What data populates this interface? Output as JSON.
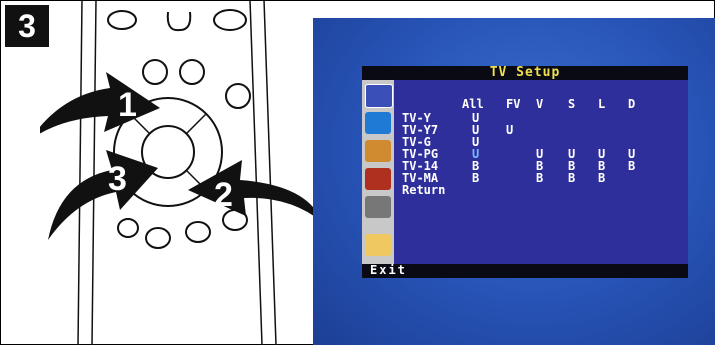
{
  "step_number": "3",
  "callouts": [
    "1",
    "2",
    "3"
  ],
  "osd": {
    "title": "TV Setup",
    "exit_label": "Exit",
    "columns": [
      "All",
      "FV",
      "V",
      "S",
      "L",
      "D"
    ],
    "rows": [
      {
        "label": "TV-Y",
        "values": [
          "U",
          "",
          "",
          "",
          "",
          ""
        ]
      },
      {
        "label": "TV-Y7",
        "values": [
          "U",
          "U",
          "",
          "",
          "",
          ""
        ]
      },
      {
        "label": "TV-G",
        "values": [
          "U",
          "",
          "",
          "",
          "",
          ""
        ]
      },
      {
        "label": "TV-PG",
        "values": [
          "U",
          "",
          "U",
          "U",
          "U",
          "U"
        ]
      },
      {
        "label": "TV-14",
        "values": [
          "B",
          "",
          "B",
          "B",
          "B",
          "B"
        ]
      },
      {
        "label": "TV-MA",
        "values": [
          "B",
          "",
          "B",
          "B",
          "B",
          ""
        ]
      }
    ],
    "return_label": "Return",
    "side_icons": [
      "video-icon",
      "picture-icon",
      "people-icon",
      "audio-icon",
      "tools-icon",
      "folder-icon"
    ]
  }
}
